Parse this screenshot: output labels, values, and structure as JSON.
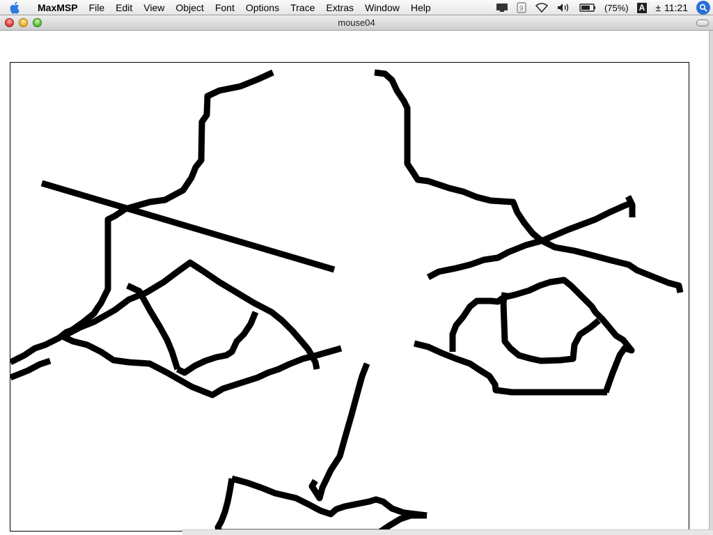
{
  "menubar": {
    "app_name": "MaxMSP",
    "items": [
      {
        "label": "File"
      },
      {
        "label": "Edit"
      },
      {
        "label": "View"
      },
      {
        "label": "Object"
      },
      {
        "label": "Font"
      },
      {
        "label": "Options"
      },
      {
        "label": "Trace"
      },
      {
        "label": "Extras"
      },
      {
        "label": "Window"
      },
      {
        "label": "Help"
      }
    ],
    "battery": "(75%)",
    "input_menu": "A",
    "clock": "11:21",
    "clock_prefix": "±"
  },
  "window": {
    "title": "mouse04"
  },
  "canvas": {
    "stroke_color": "#000000",
    "background": "#ffffff"
  }
}
